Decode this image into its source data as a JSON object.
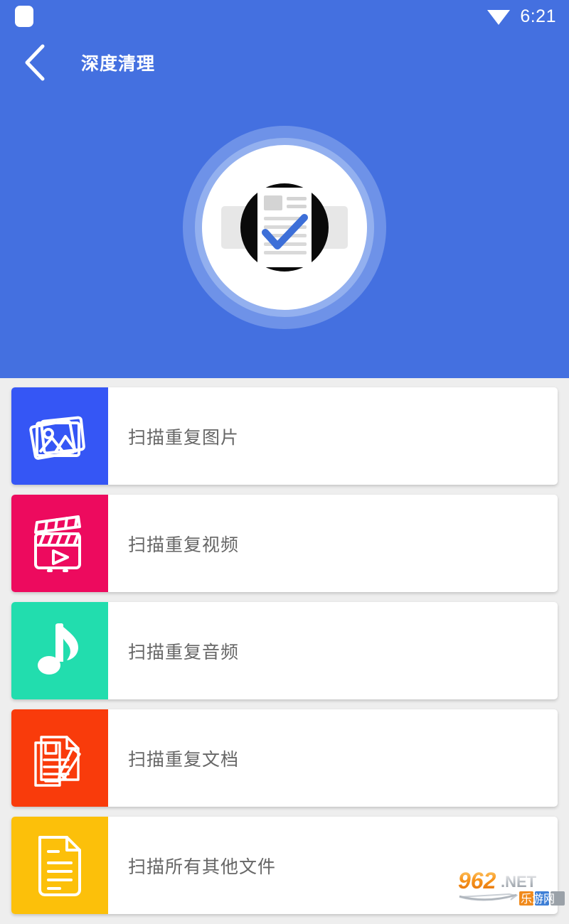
{
  "statusbar": {
    "notification_icon": "rounded-square-icon",
    "wifi_icon": "wifi-icon",
    "time": "6:21"
  },
  "appbar": {
    "back_icon": "chevron-left-icon",
    "title": "深度清理"
  },
  "hero": {
    "icon_name": "deep-clean-scan-illustration",
    "ring_outer_color": "#6E92E8",
    "ring_mid_color": "#93B0EF",
    "ring_inner_color": "#FFFFFF",
    "check_color": "#3D6FD8"
  },
  "theme": {
    "header_blue": "#4470E0",
    "page_background": "#EEEEEE",
    "card_background": "#FFFFFF",
    "label_color": "#666666"
  },
  "list": {
    "items": [
      {
        "label": "扫描重复图片",
        "icon": "photos-stack-icon",
        "color": "#3556F5"
      },
      {
        "label": "扫描重复视频",
        "icon": "clapperboard-icon",
        "color": "#ED0A5E"
      },
      {
        "label": "扫描重复音频",
        "icon": "music-note-icon",
        "color": "#22DDAE"
      },
      {
        "label": "扫描重复文档",
        "icon": "document-pen-icon",
        "color": "#F93B0B"
      },
      {
        "label": "扫描所有其他文件",
        "icon": "file-lines-icon",
        "color": "#FCC00A"
      }
    ]
  },
  "watermark": {
    "primary": "962",
    "secondary": ".NET",
    "tagline": "乐游网"
  }
}
